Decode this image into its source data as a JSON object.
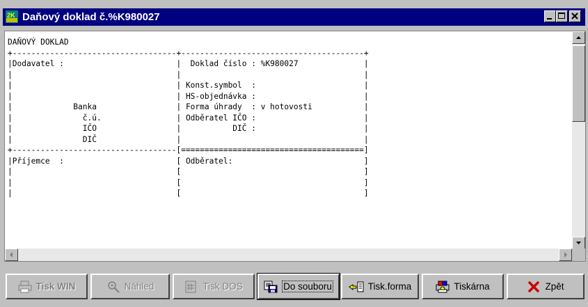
{
  "window": {
    "title": "Daňový doklad č.%K980027",
    "icon": "app-2k-icon"
  },
  "document_lines": [
    "DAŇOVÝ DOKLAD",
    "+-----------------------------------+---------------------------------------+",
    "|Dodavatel :                        |  Doklad číslo : %K980027              |",
    "|                                   |                                       |",
    "|                                   | Konst.symbol  :                       |",
    "|                                   | HS-objednávka :                       |",
    "|             Banka                 | Forma úhrady  : v hotovosti           |",
    "|               č.ú.                | Odběratel IČO :                       |",
    "|               IČO                 |           DIČ :                       |",
    "|               DIČ                 |                                       |",
    "+-----------------------------------[=======================================]",
    "|Příjemce  :                        [ Odběratel:                            ]",
    "|                                   [                                       ]",
    "|                                   [                                       ]",
    "|                                   [                                       ]"
  ],
  "buttons": {
    "tisk_win": {
      "label": "Tisk WIN",
      "icon": "printer-icon",
      "enabled": false
    },
    "nahled": {
      "label": "Náhled",
      "icon": "magnifier-icon",
      "enabled": false
    },
    "tisk_dos": {
      "label": "Tisk DOS",
      "icon": "dos-print-icon",
      "enabled": false
    },
    "do_souboru": {
      "label": "Do souboru",
      "icon": "save-to-file-icon",
      "enabled": true
    },
    "tisk_forma": {
      "label": "Tisk.forma",
      "icon": "form-pointer-icon",
      "enabled": true
    },
    "tiskarna": {
      "label": "Tiskárna",
      "icon": "printer-setup-icon",
      "enabled": true
    },
    "zpet": {
      "label": "Zpět",
      "icon": "red-x-icon",
      "enabled": true
    }
  },
  "colors": {
    "titlebar": "#000080",
    "face": "#c0c0c0",
    "disabled_text": "#808080",
    "close_x": "#cc0000"
  }
}
